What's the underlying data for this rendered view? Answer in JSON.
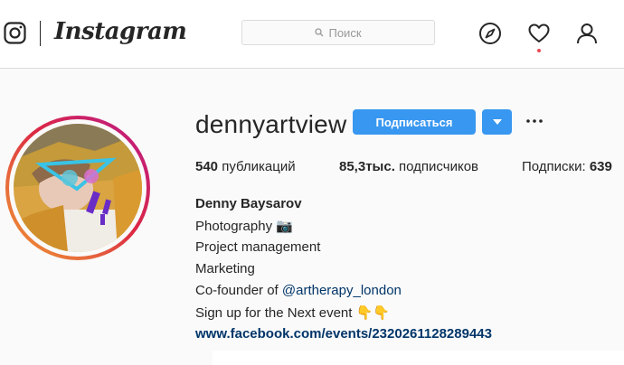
{
  "nav": {
    "logo_text": "Instagram",
    "search_placeholder": "Поиск",
    "icons": [
      "instagram-glyph-icon",
      "search-icon",
      "compass-icon",
      "heart-icon",
      "profile-icon"
    ],
    "notification_dot_color": "#ed4956"
  },
  "profile": {
    "username": "dennyartview",
    "follow_label": "Подписаться",
    "stats": {
      "posts_count": "540",
      "posts_label": "публикаций",
      "followers_count": "85,3тыс.",
      "followers_label": "подписчиков",
      "following_label": "Подписки:",
      "following_count": "639"
    },
    "bio": {
      "name": "Denny Baysarov",
      "line1": "Photography 📷",
      "line2": "Project management",
      "line3": "Marketing",
      "line4_prefix": "Co-founder of ",
      "line4_mention": "@artherapy_london",
      "line5": "Sign up for the Next event 👇👇",
      "link": "www.facebook.com/events/2320261128289443"
    }
  },
  "colors": {
    "accent": "#3897f0",
    "link": "#003569",
    "text": "#262626",
    "background": "#fafafa"
  }
}
